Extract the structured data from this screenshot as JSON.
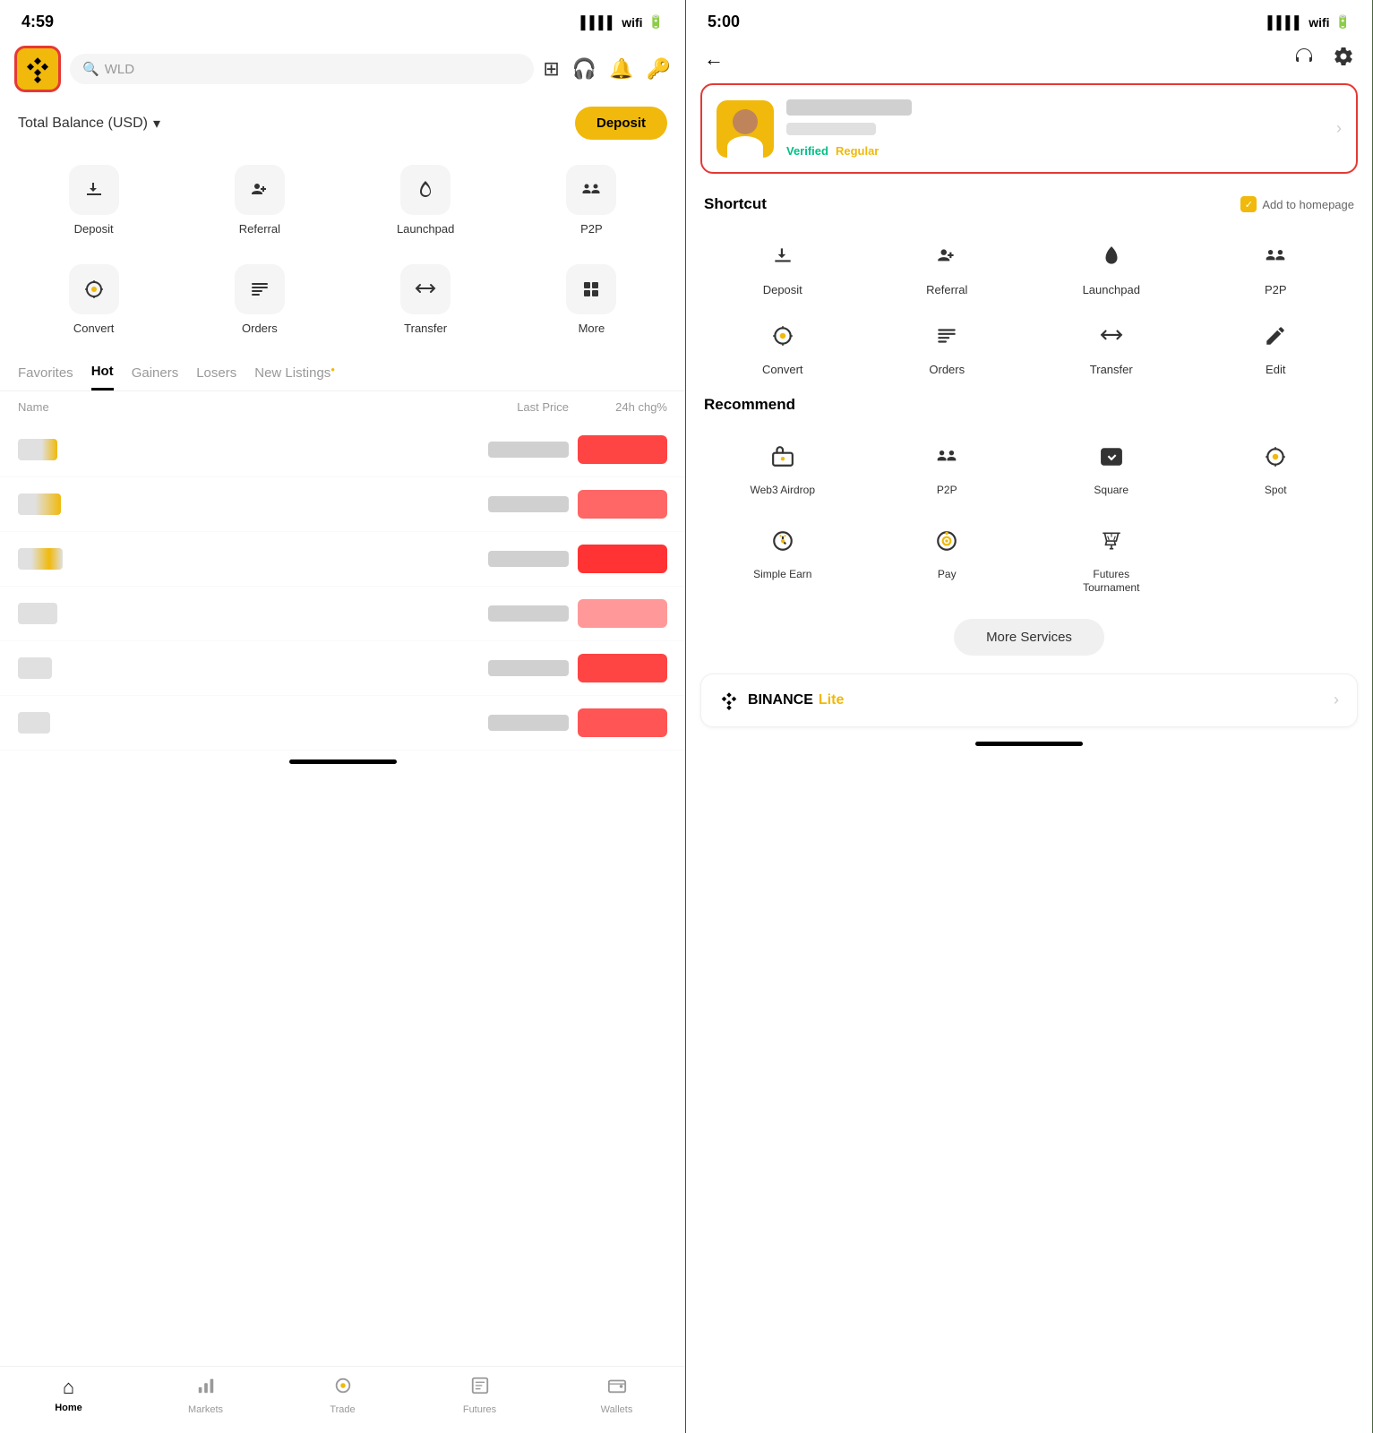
{
  "left": {
    "status": {
      "time": "4:59",
      "arrow": "▲"
    },
    "search_placeholder": "WLD",
    "balance_title": "Total Balance (USD)",
    "balance_chevron": "▾",
    "deposit_label": "Deposit",
    "quick_actions": [
      {
        "label": "Deposit",
        "icon": "⬇"
      },
      {
        "label": "Referral",
        "icon": "👤+"
      },
      {
        "label": "Launchpad",
        "icon": "🚀"
      },
      {
        "label": "P2P",
        "icon": "👥"
      },
      {
        "label": "Convert",
        "icon": "◎"
      },
      {
        "label": "Orders",
        "icon": "≡"
      },
      {
        "label": "Transfer",
        "icon": "⇄"
      },
      {
        "label": "More",
        "icon": "⊞"
      }
    ],
    "tabs": [
      {
        "label": "Favorites",
        "active": false
      },
      {
        "label": "Hot",
        "active": true
      },
      {
        "label": "Gainers",
        "active": false
      },
      {
        "label": "Losers",
        "active": false
      },
      {
        "label": "New Listings",
        "active": false,
        "dot": true
      }
    ],
    "market_cols": {
      "name": "Name",
      "price": "Last Price",
      "change": "24h chg%"
    },
    "bottom_nav": [
      {
        "label": "Home",
        "active": true,
        "icon": "⌂"
      },
      {
        "label": "Markets",
        "active": false,
        "icon": "📊"
      },
      {
        "label": "Trade",
        "active": false,
        "icon": "◎"
      },
      {
        "label": "Futures",
        "active": false,
        "icon": "📋"
      },
      {
        "label": "Wallets",
        "active": false,
        "icon": "💳"
      }
    ]
  },
  "right": {
    "status": {
      "time": "5:00",
      "arrow": "▲"
    },
    "back_label": "←",
    "profile": {
      "verified_label": "Verified",
      "regular_label": "Regular"
    },
    "shortcut": {
      "title": "Shortcut",
      "add_homepage": "Add to homepage",
      "items": [
        {
          "label": "Deposit",
          "icon": "⬇"
        },
        {
          "label": "Referral",
          "icon": "👤+"
        },
        {
          "label": "Launchpad",
          "icon": "🚀"
        },
        {
          "label": "P2P",
          "icon": "👥"
        },
        {
          "label": "Convert",
          "icon": "◎"
        },
        {
          "label": "Orders",
          "icon": "≡"
        },
        {
          "label": "Transfer",
          "icon": "⇄"
        },
        {
          "label": "Edit",
          "icon": "✎"
        }
      ]
    },
    "recommend": {
      "title": "Recommend",
      "items": [
        {
          "label": "Web3 Airdrop",
          "icon": "📁"
        },
        {
          "label": "P2P",
          "icon": "👥"
        },
        {
          "label": "Square",
          "icon": "📡"
        },
        {
          "label": "Spot",
          "icon": "◎"
        },
        {
          "label": "Simple Earn",
          "icon": "🔐"
        },
        {
          "label": "Pay",
          "icon": "💰"
        },
        {
          "label": "Futures\nTournament",
          "icon": "👑"
        }
      ]
    },
    "more_services": "More Services",
    "binance_lite": {
      "logo": "✦",
      "binance": "BINANCE",
      "lite": "Lite"
    }
  }
}
